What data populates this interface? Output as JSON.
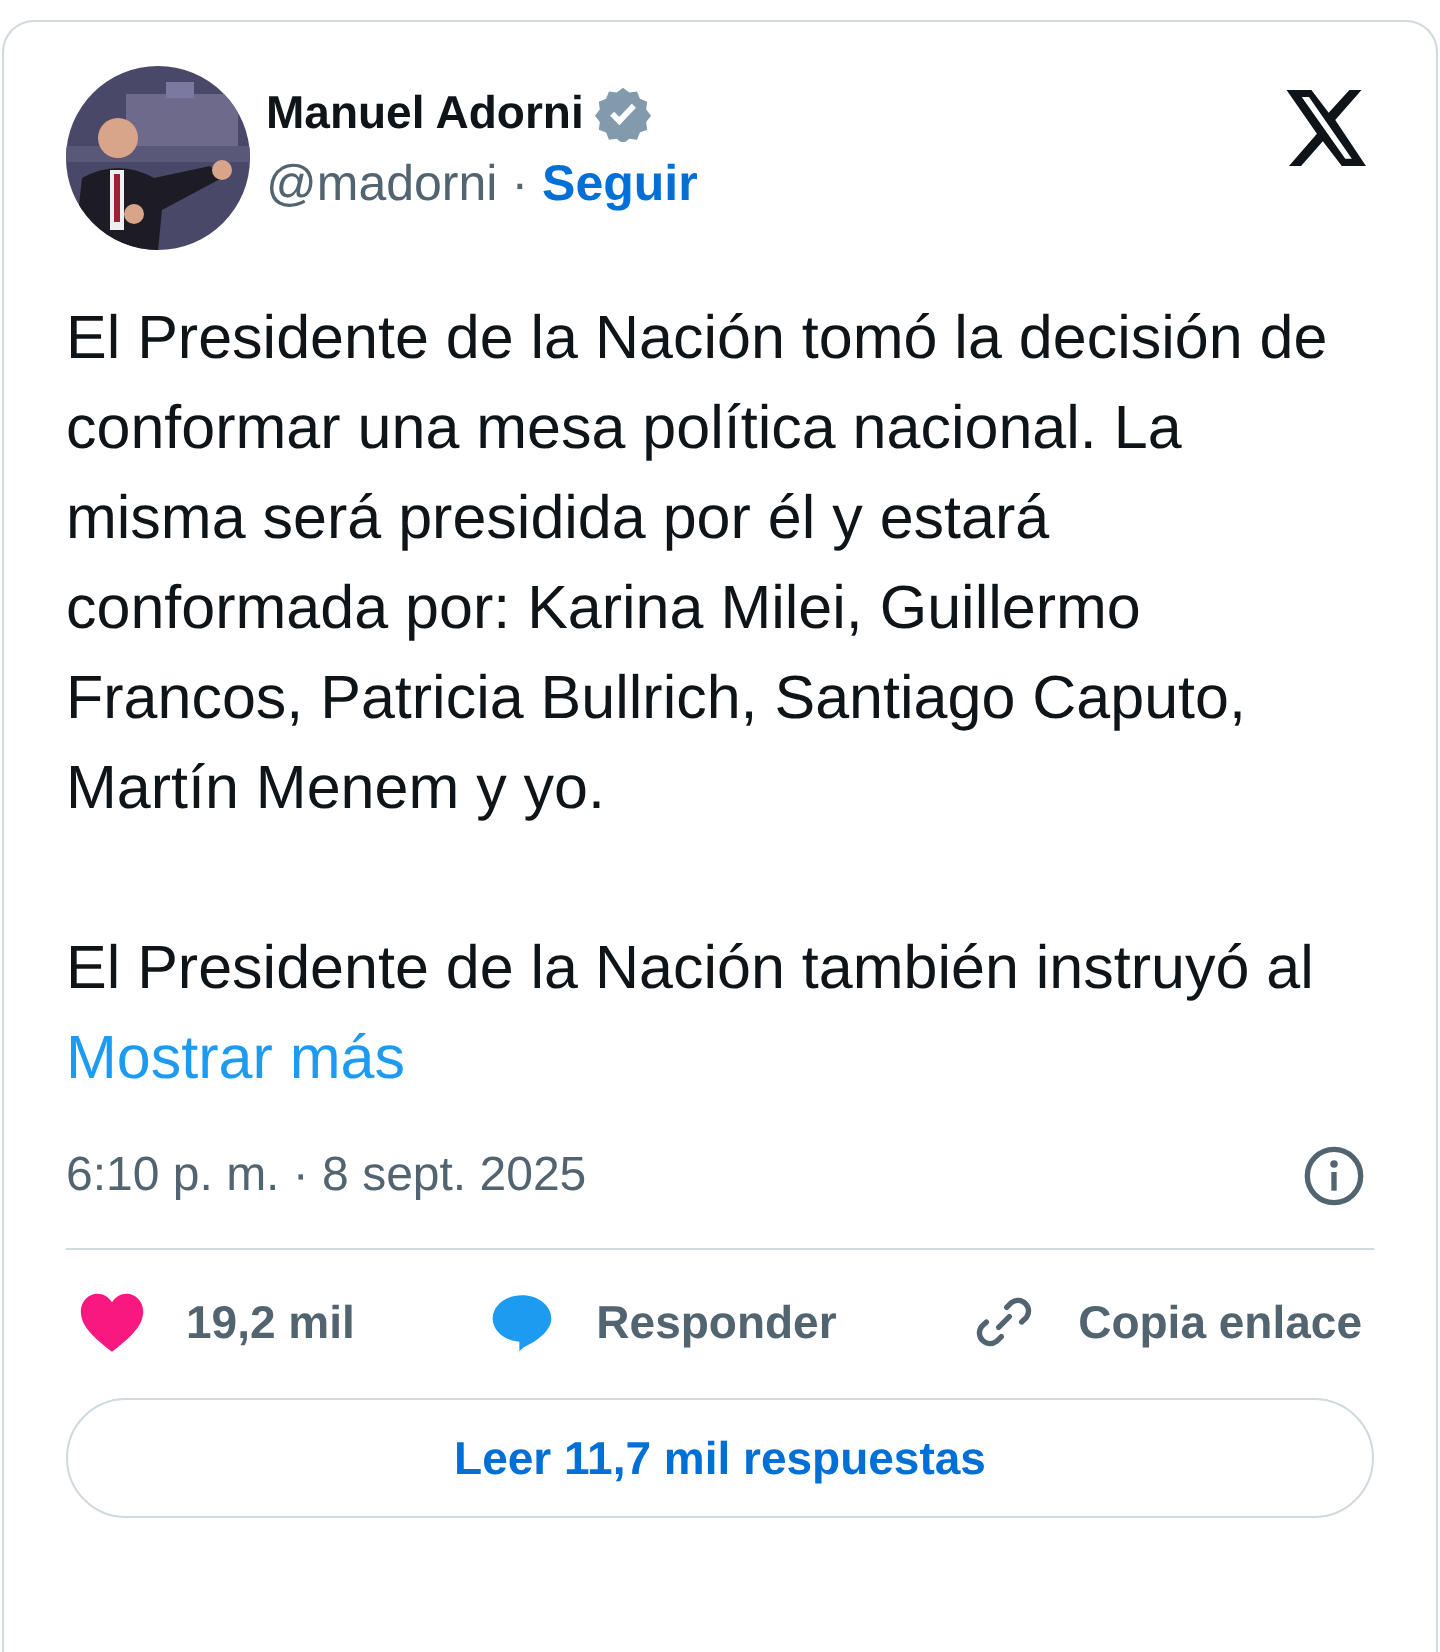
{
  "author": {
    "name": "Manuel Adorni",
    "verified": true,
    "handle": "@madorni",
    "separator": "·",
    "follow": "Seguir"
  },
  "paragraphs": [
    "El Presidente de la Nación tomó la decisión de conformar una mesa política nacional. La misma será presidida por él y estará conformada por: Karina Milei, Guillermo Francos, Patricia Bullrich, Santiago Caputo, Martín Menem y yo.",
    "El Presidente de la Nación también instruyó al"
  ],
  "show_more": "Mostrar más",
  "timestamp": "6:10 p. m. · 8 sept. 2025",
  "actions": [
    {
      "kind": "like",
      "label": "19,2 mil"
    },
    {
      "kind": "reply",
      "label": "Responder"
    },
    {
      "kind": "copy",
      "label": "Copia enlace"
    }
  ],
  "read_replies": "Leer 11,7 mil respuestas"
}
